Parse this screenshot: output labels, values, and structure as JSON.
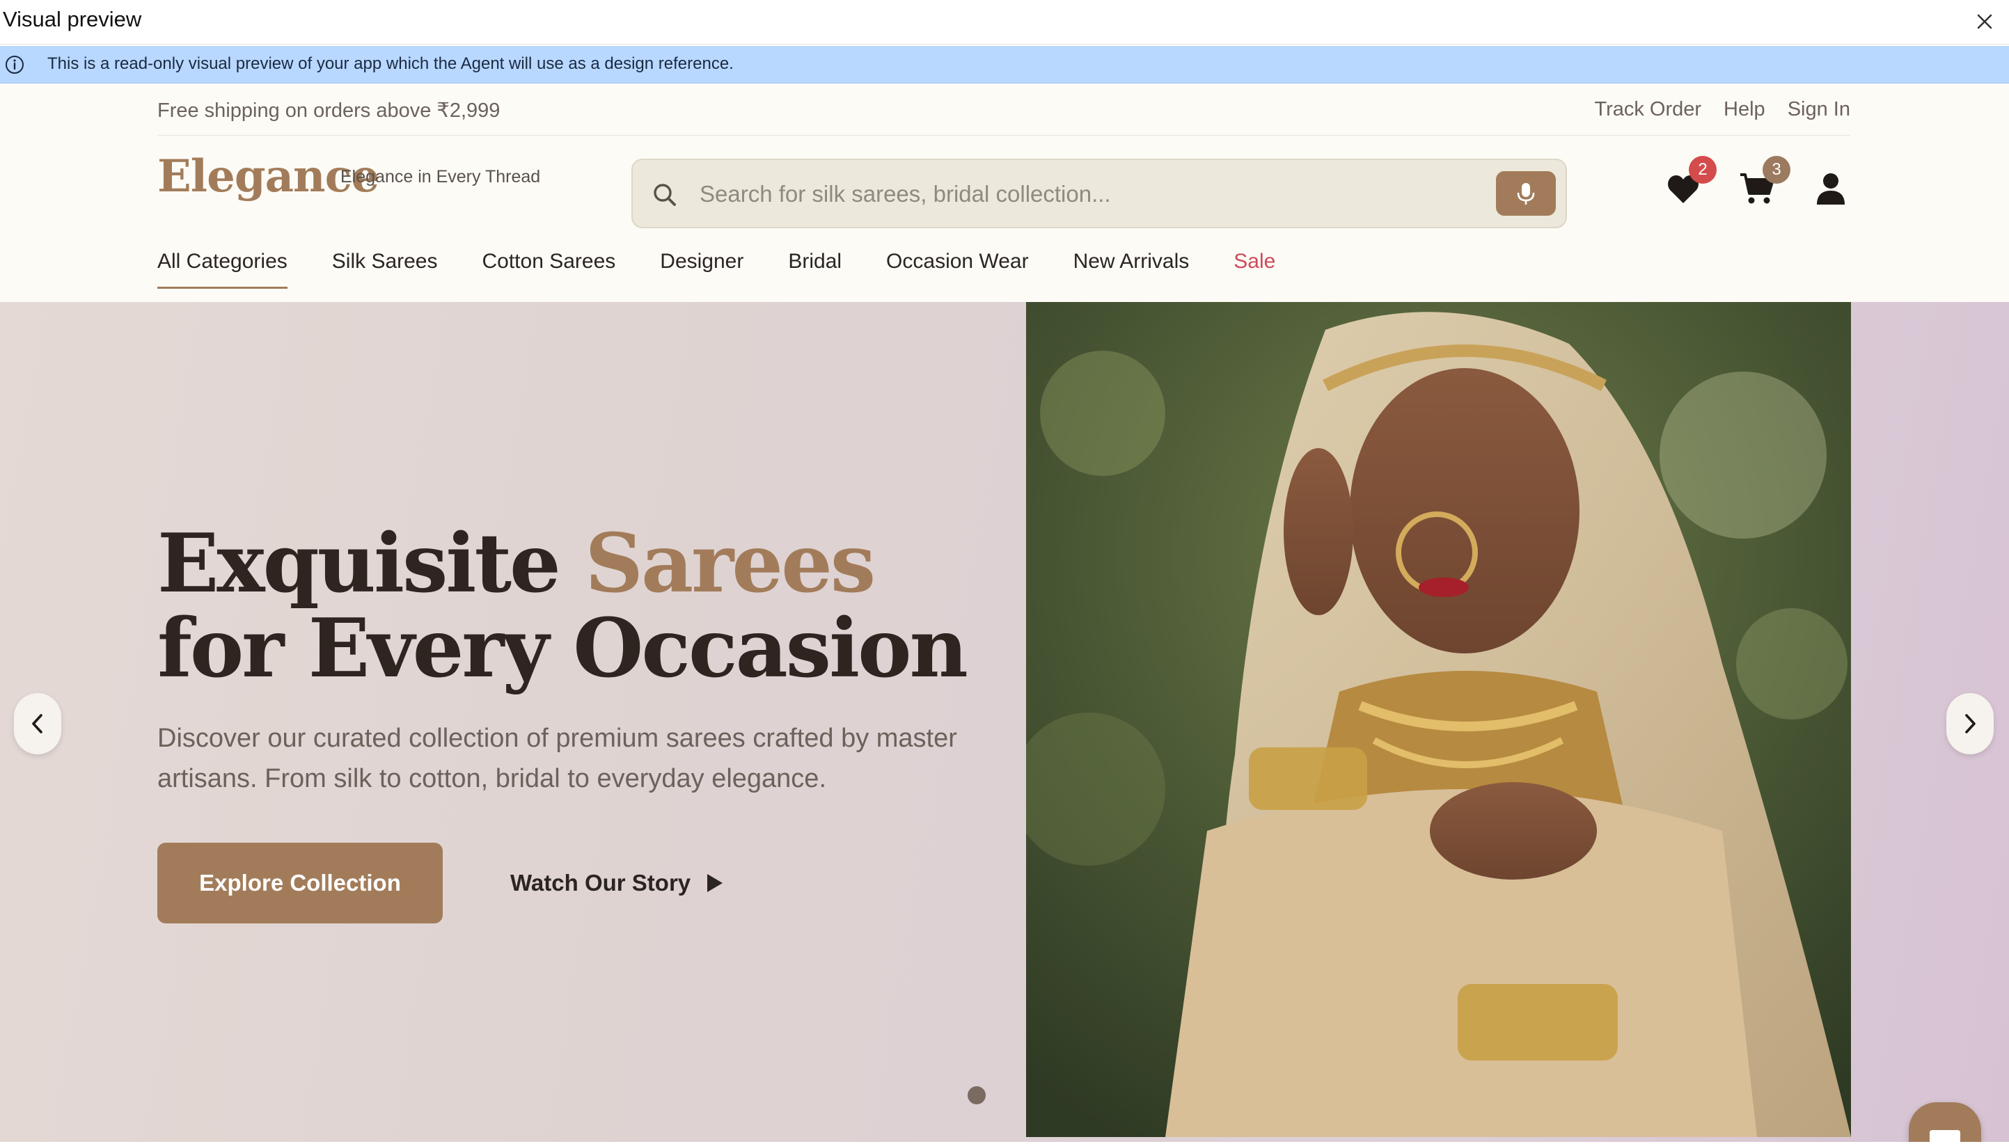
{
  "preview": {
    "title": "Visual preview",
    "info_text": "This is a read-only visual preview of your app which the Agent will use as a design reference."
  },
  "topbar": {
    "shipping_text": "Free shipping on orders above ₹2,999",
    "links": [
      "Track Order",
      "Help",
      "Sign In"
    ]
  },
  "header": {
    "logo": "Elegance",
    "tagline": "Elegance in Every Thread",
    "search_placeholder": "Search for silk sarees, bridal collection...",
    "wishlist_count": "2",
    "cart_count": "3"
  },
  "nav": {
    "items": [
      "All Categories",
      "Silk Sarees",
      "Cotton Sarees",
      "Designer",
      "Bridal",
      "Occasion Wear",
      "New Arrivals",
      "Sale"
    ],
    "active_index": 0
  },
  "hero": {
    "title_part1": "Exquisite",
    "title_accent": "Sarees",
    "title_part2": "for Every Occasion",
    "description": "Discover our curated collection of premium sarees crafted by master artisans. From silk to cotton, bridal to everyday elegance.",
    "primary_cta": "Explore Collection",
    "secondary_cta": "Watch Our Story",
    "slide_count": 1,
    "active_slide": 1
  },
  "colors": {
    "brand": "#a27c5a",
    "sale": "#cc4b5a",
    "badge_red": "#d44b4b",
    "info_banner": "#b9d8ff"
  },
  "icons": [
    "info-icon",
    "close-icon",
    "search-icon",
    "microphone-icon",
    "heart-icon",
    "cart-icon",
    "user-icon",
    "chevron-left-icon",
    "chevron-right-icon",
    "play-icon",
    "chat-icon"
  ]
}
